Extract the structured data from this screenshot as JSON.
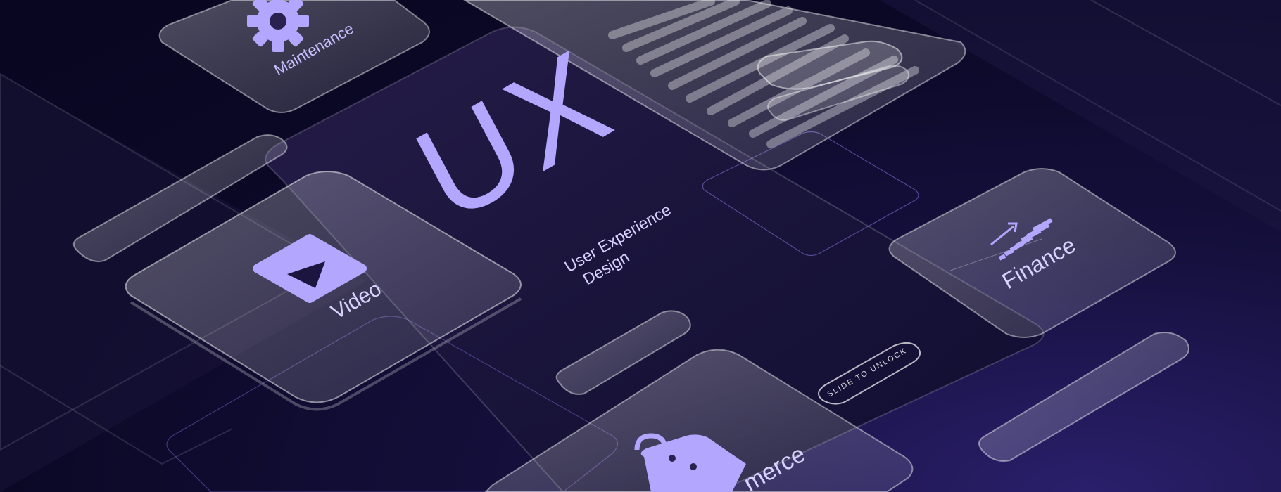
{
  "hero": {
    "title": "UX",
    "subtitle_line1": "User Experience",
    "subtitle_line2": "Design"
  },
  "cards": {
    "maintenance": {
      "label": "Maintenance",
      "icon": "gear-icon"
    },
    "video": {
      "label": "Video",
      "icon": "play-icon"
    },
    "finance": {
      "label": "Finance",
      "icon": "bar-chart-icon"
    },
    "commerce": {
      "label": "merce",
      "icon": "shopping-bag-icon"
    }
  },
  "unlock": {
    "label": "SLIDE TO UNLOCK"
  },
  "colors": {
    "accent": "#b3a6ff",
    "background": "#0b0826",
    "glass_fill": "#ffffff",
    "text_light": "#d9d2ff"
  }
}
